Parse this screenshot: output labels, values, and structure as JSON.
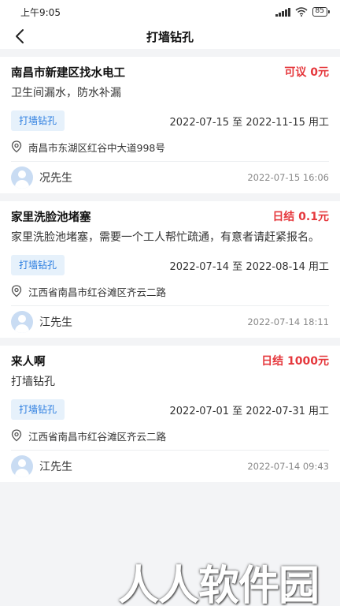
{
  "status_bar": {
    "time": "上午9:05",
    "battery": "85"
  },
  "nav": {
    "title": "打墙钻孔"
  },
  "jobs": [
    {
      "title": "南昌市新建区找水电工",
      "price": "可议 0元",
      "description": "卫生间漏水，防水补漏",
      "tag": "打墙钻孔",
      "period": "2022-07-15 至 2022-11-15 用工",
      "address": "南昌市东湖区红谷中大道998号",
      "user": "况先生",
      "posted_at": "2022-07-15 16:06"
    },
    {
      "title": "家里洗脸池堵塞",
      "price": "日结 0.1元",
      "description": "家里洗脸池堵塞，需要一个工人帮忙疏通，有意者请赶紧报名。",
      "tag": "打墙钻孔",
      "period": "2022-07-14 至 2022-08-14 用工",
      "address": "江西省南昌市红谷滩区齐云二路",
      "user": "江先生",
      "posted_at": "2022-07-14 18:11"
    },
    {
      "title": "来人啊",
      "price": "日结 1000元",
      "description": "打墙钻孔",
      "tag": "打墙钻孔",
      "period": "2022-07-01 至 2022-07-31 用工",
      "address": "江西省南昌市红谷滩区齐云二路",
      "user": "江先生",
      "posted_at": "2022-07-14 09:43"
    }
  ],
  "watermark": "人人软件园",
  "colors": {
    "price": "#e5373c",
    "tag_text": "#2b7de0",
    "tag_bg": "#e6f1fb"
  }
}
